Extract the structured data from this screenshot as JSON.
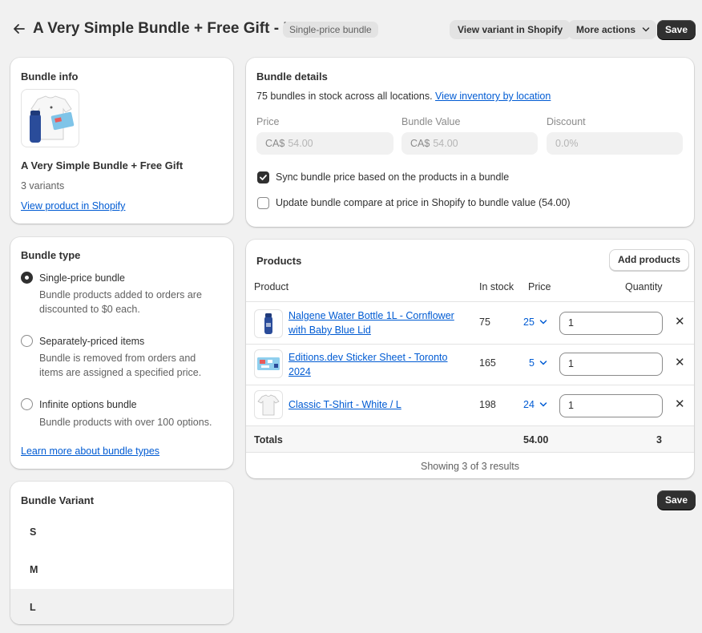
{
  "header": {
    "title": "A Very Simple Bundle + Free Gift - L",
    "badge": "Single-price bundle",
    "view_variant_label": "View variant in Shopify",
    "more_actions_label": "More actions",
    "save_label": "Save"
  },
  "bundle_info": {
    "heading": "Bundle info",
    "product_name": "A Very Simple Bundle + Free Gift",
    "variants_text": "3 variants",
    "view_product_link": "View product in Shopify"
  },
  "bundle_type": {
    "heading": "Bundle type",
    "options": [
      {
        "label": "Single-price bundle",
        "description_1": "Bundle products added to orders are",
        "description_2": "discounted to $0 each.",
        "selected": true
      },
      {
        "label": "Separately-priced items",
        "description_1": "Bundle is removed from orders and",
        "description_2": "items are assigned a specified price.",
        "selected": false
      },
      {
        "label": "Infinite options bundle",
        "description_1": "Bundle products with over 100 options.",
        "description_2": "",
        "selected": false
      }
    ],
    "learn_more_link": "Learn more about bundle types"
  },
  "bundle_variant": {
    "heading": "Bundle Variant",
    "items": [
      "S",
      "M",
      "L"
    ],
    "selected": "L"
  },
  "bundle_details": {
    "heading": "Bundle details",
    "stock_text": "75 bundles in stock across all locations.",
    "inventory_link": "View inventory by location",
    "price_label": "Price",
    "price_prefix": "CA$",
    "price_value": "54.00",
    "bundle_value_label": "Bundle Value",
    "bundle_value_prefix": "CA$",
    "bundle_value_value": "54.00",
    "discount_label": "Discount",
    "discount_value": "0.0%",
    "sync_label": "Sync bundle price based on the products in a bundle",
    "sync_checked": true,
    "compare_label": "Update bundle compare at price in Shopify to bundle value (54.00)",
    "compare_checked": false
  },
  "products": {
    "heading": "Products",
    "add_button": "Add products",
    "columns": {
      "product": "Product",
      "in_stock": "In stock",
      "price": "Price",
      "quantity": "Quantity"
    },
    "rows": [
      {
        "name": "Nalgene Water Bottle 1L - Cornflower with Baby Blue Lid",
        "in_stock": "75",
        "price": "25",
        "quantity": "1",
        "thumb": "water-bottle"
      },
      {
        "name": "Editions.dev Sticker Sheet - Toronto 2024",
        "in_stock": "165",
        "price": "5",
        "quantity": "1",
        "thumb": "sticker-sheet"
      },
      {
        "name": "Classic T-Shirt - White / L",
        "in_stock": "198",
        "price": "24",
        "quantity": "1",
        "thumb": "t-shirt"
      }
    ],
    "totals_label": "Totals",
    "totals_price": "54.00",
    "totals_quantity": "3",
    "footer_text": "Showing 3 of 3 results"
  },
  "colors": {
    "primary": "#303030",
    "link": "#005bd3",
    "background": "#f1f1f1"
  }
}
